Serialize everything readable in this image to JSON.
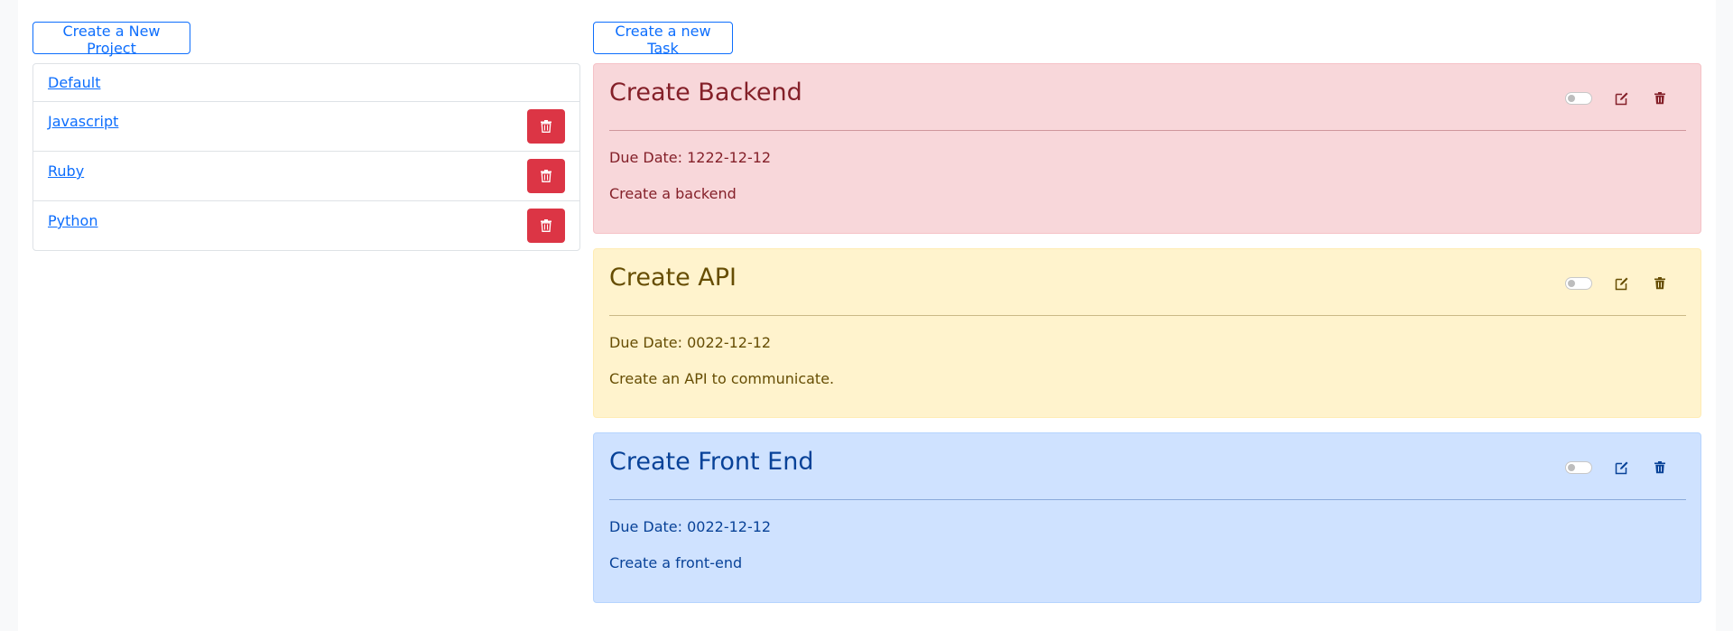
{
  "toolbar": {
    "new_project_label": "Create a New Project",
    "new_task_label": "Create a new Task"
  },
  "projects": [
    {
      "name": "Default",
      "deletable": false
    },
    {
      "name": "Javascript",
      "deletable": true
    },
    {
      "name": "Ruby",
      "deletable": true
    },
    {
      "name": "Python",
      "deletable": true
    }
  ],
  "tasks": [
    {
      "title": "Create Backend",
      "due": "Due Date: 1222-12-12",
      "description": "Create a backend",
      "priority_color": "#f8d7da",
      "text_color": "#842029",
      "completed": false
    },
    {
      "title": "Create API",
      "due": "Due Date: 0022-12-12",
      "description": "Create an API to communicate.",
      "priority_color": "#fff3cd",
      "text_color": "#664d03",
      "completed": false
    },
    {
      "title": "Create Front End",
      "due": "Due Date: 0022-12-12",
      "description": "Create a front-end",
      "priority_color": "#cfe2ff",
      "text_color": "#084298",
      "completed": false
    }
  ],
  "icons": {
    "delete": "trash-icon",
    "edit": "edit-icon",
    "toggle": "toggle-switch"
  },
  "colors": {
    "primary": "#0d6efd",
    "danger": "#dc3545"
  }
}
